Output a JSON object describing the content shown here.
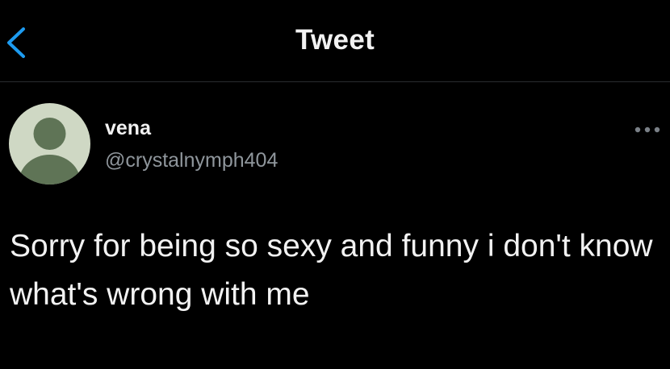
{
  "header": {
    "title": "Tweet",
    "back_icon": "chevron-left-icon"
  },
  "tweet": {
    "author": {
      "display_name": "vena",
      "handle": "@crystalnymph404",
      "avatar_icon": "default-avatar-icon"
    },
    "more_icon": "more-options-icon",
    "text": "Sorry for being so sexy and funny i don't know what's wrong with me"
  },
  "colors": {
    "background": "#000000",
    "accent": "#1d9bf0",
    "primary_text": "#f2f2f2",
    "secondary_text": "#8f969c",
    "avatar_bg": "#cfd8c4",
    "avatar_figure": "#5f7456"
  }
}
